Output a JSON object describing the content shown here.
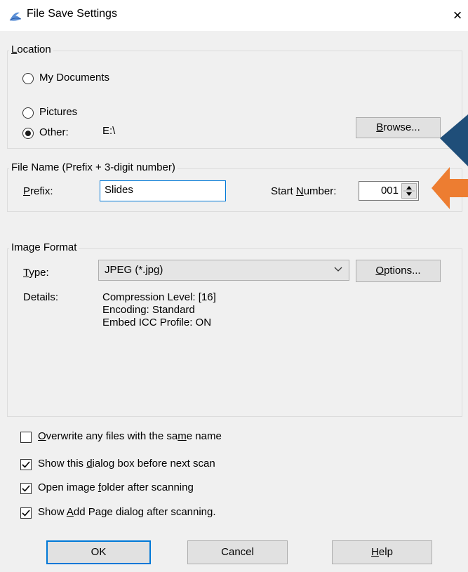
{
  "window": {
    "title": "File Save Settings",
    "close_glyph": "×"
  },
  "location": {
    "group_label": "Location",
    "options": [
      "My Documents",
      "Pictures",
      "Other:"
    ],
    "selected": "Other:",
    "other_path": "E:\\",
    "browse_label": "Browse..."
  },
  "file_name": {
    "group_label": "File Name (Prefix + 3-digit number)",
    "prefix_label": "Prefix:",
    "prefix_value": "Slides",
    "start_number_label": "Start Number:",
    "start_number_value": "001"
  },
  "image_format": {
    "group_label": "Image Format",
    "type_label": "Type:",
    "type_value": "JPEG (*.jpg)",
    "options_label": "Options...",
    "details_label": "Details:",
    "details": [
      "Compression Level: [16]",
      "Encoding: Standard",
      "Embed ICC Profile: ON"
    ]
  },
  "checkboxes": [
    {
      "label": "Overwrite any files with the same name",
      "checked": false
    },
    {
      "label": "Show this dialog box before next scan",
      "checked": true
    },
    {
      "label": "Open image folder after scanning",
      "checked": true
    },
    {
      "label": "Show Add Page dialog after scanning.",
      "checked": true
    }
  ],
  "buttons": {
    "ok": "OK",
    "cancel": "Cancel",
    "help": "Help"
  },
  "annotations": {
    "arrow_blue_color": "#1f4e79",
    "arrow_orange_color": "#ed7d31"
  }
}
